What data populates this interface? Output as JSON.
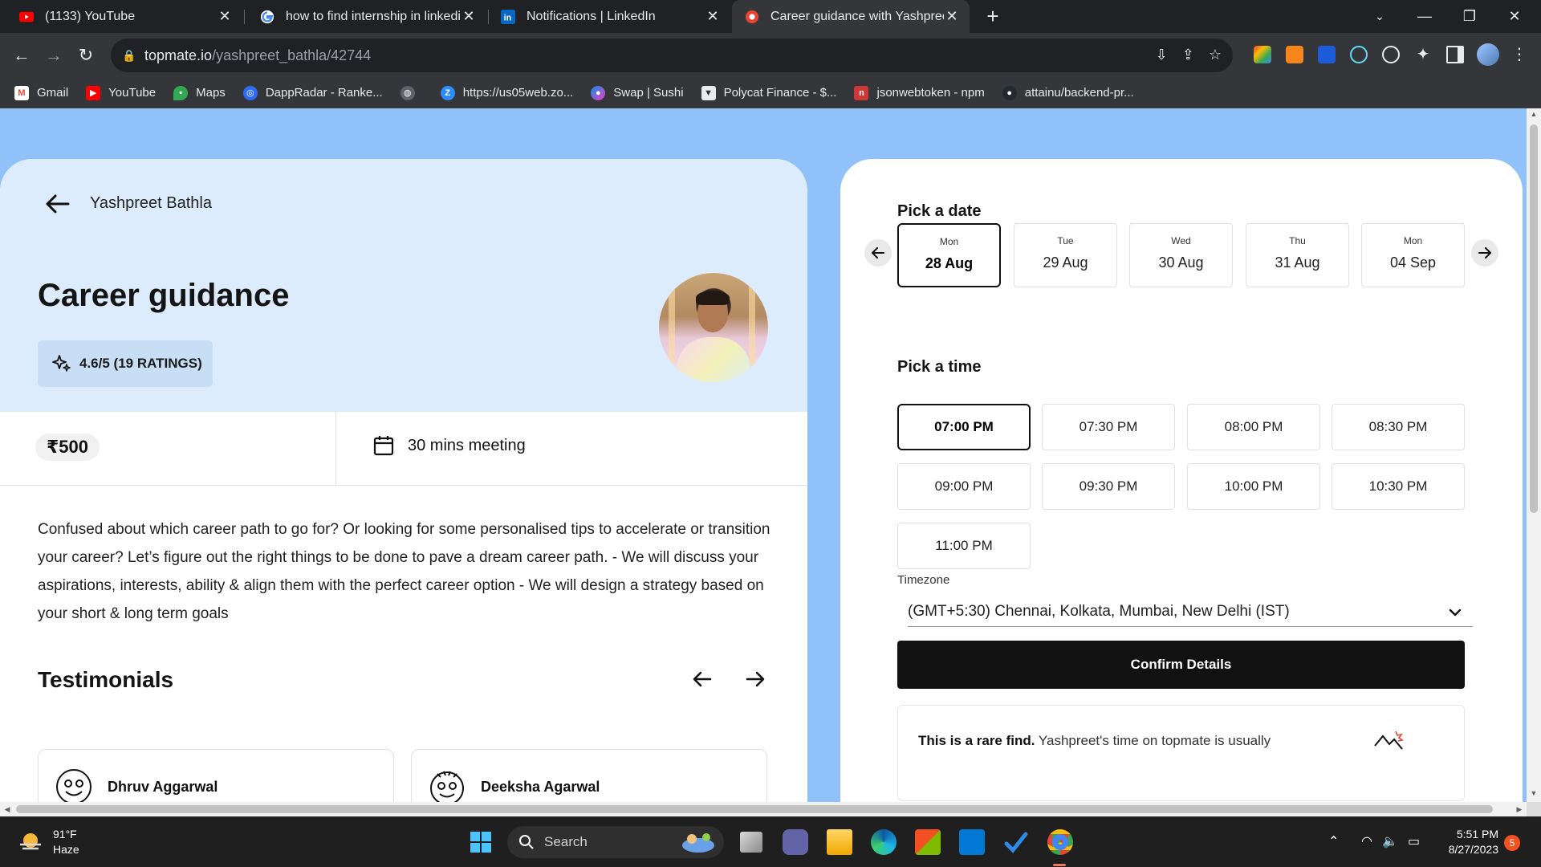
{
  "browser": {
    "tabs": [
      {
        "title": "(1133) YouTube",
        "icon": "youtube-icon"
      },
      {
        "title": "how to find internship in linkedin",
        "icon": "google-icon"
      },
      {
        "title": "Notifications | LinkedIn",
        "icon": "linkedin-icon"
      },
      {
        "title": "Career guidance with Yashpreet B",
        "icon": "topmate-icon",
        "active": true
      }
    ],
    "url_host": "topmate.io",
    "url_path": "/yashpreet_bathla/42744",
    "bookmarks": [
      {
        "label": "Gmail",
        "icon": "gmail-icon"
      },
      {
        "label": "YouTube",
        "icon": "youtube-icon"
      },
      {
        "label": "Maps",
        "icon": "maps-icon"
      },
      {
        "label": "DappRadar - Ranke...",
        "icon": "dappradar-icon"
      },
      {
        "label": "",
        "icon": "globe-icon"
      },
      {
        "label": "https://us05web.zo...",
        "icon": "zoom-icon"
      },
      {
        "label": "Swap | Sushi",
        "icon": "sushi-icon"
      },
      {
        "label": "Polycat Finance - $...",
        "icon": "polycat-icon"
      },
      {
        "label": "jsonwebtoken - npm",
        "icon": "npm-icon"
      },
      {
        "label": "attainu/backend-pr...",
        "icon": "github-icon"
      }
    ]
  },
  "page": {
    "expert_name": "Yashpreet Bathla",
    "service_title": "Career guidance",
    "rating": "4.6/5 (19 RATINGS)",
    "price": "₹500",
    "meeting": "30 mins meeting",
    "description": "Confused about which career path to go for? Or looking for some personalised tips to accelerate or transition your career? Let’s figure out the right things to be done to pave a dream career path. - We will discuss your aspirations, interests, ability & align them with the perfect career option - We will design a strategy based on your short & long term goals",
    "testimonials_title": "Testimonials",
    "testimonials": [
      {
        "name": "Dhruv Aggarwal"
      },
      {
        "name": "Deeksha Agarwal"
      }
    ]
  },
  "booking": {
    "pick_date_label": "Pick a date",
    "dates": [
      {
        "dow": "Mon",
        "date": "28 Aug",
        "selected": true
      },
      {
        "dow": "Tue",
        "date": "29 Aug"
      },
      {
        "dow": "Wed",
        "date": "30 Aug"
      },
      {
        "dow": "Thu",
        "date": "31 Aug"
      },
      {
        "dow": "Mon",
        "date": "04 Sep"
      }
    ],
    "pick_time_label": "Pick a time",
    "times": [
      "07:00 PM",
      "07:30 PM",
      "08:00 PM",
      "08:30 PM",
      "09:00 PM",
      "09:30 PM",
      "10:00 PM",
      "10:30 PM",
      "11:00 PM"
    ],
    "selected_time": "07:00 PM",
    "timezone_label": "Timezone",
    "timezone_value": "(GMT+5:30) Chennai, Kolkata, Mumbai, New Delhi (IST)",
    "confirm_label": "Confirm Details",
    "rare_bold": "This is a rare find.",
    "rare_text": " Yashpreet's time on topmate is usually"
  },
  "taskbar": {
    "temperature": "91°F",
    "condition": "Haze",
    "search_label": "Search",
    "time": "5:51 PM",
    "date": "8/27/2023",
    "notification_count": "5"
  },
  "colors": {
    "page_background": "#90c2f9",
    "card_header": "#ddecfc",
    "rating_pill": "#c8def5",
    "confirm_button": "#111111"
  }
}
